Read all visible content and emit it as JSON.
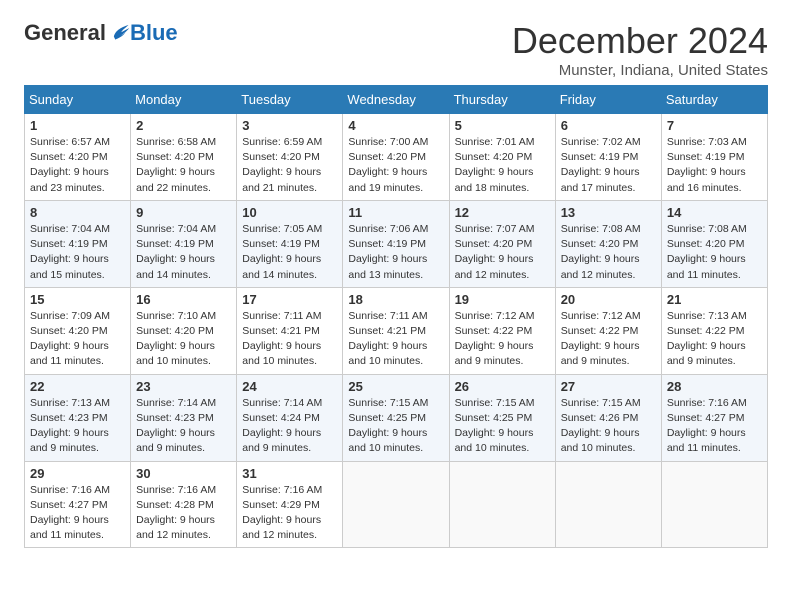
{
  "header": {
    "logo_general": "General",
    "logo_blue": "Blue",
    "title": "December 2024",
    "subtitle": "Munster, Indiana, United States"
  },
  "days_of_week": [
    "Sunday",
    "Monday",
    "Tuesday",
    "Wednesday",
    "Thursday",
    "Friday",
    "Saturday"
  ],
  "weeks": [
    [
      {
        "day": "1",
        "info": "Sunrise: 6:57 AM\nSunset: 4:20 PM\nDaylight: 9 hours\nand 23 minutes."
      },
      {
        "day": "2",
        "info": "Sunrise: 6:58 AM\nSunset: 4:20 PM\nDaylight: 9 hours\nand 22 minutes."
      },
      {
        "day": "3",
        "info": "Sunrise: 6:59 AM\nSunset: 4:20 PM\nDaylight: 9 hours\nand 21 minutes."
      },
      {
        "day": "4",
        "info": "Sunrise: 7:00 AM\nSunset: 4:20 PM\nDaylight: 9 hours\nand 19 minutes."
      },
      {
        "day": "5",
        "info": "Sunrise: 7:01 AM\nSunset: 4:20 PM\nDaylight: 9 hours\nand 18 minutes."
      },
      {
        "day": "6",
        "info": "Sunrise: 7:02 AM\nSunset: 4:19 PM\nDaylight: 9 hours\nand 17 minutes."
      },
      {
        "day": "7",
        "info": "Sunrise: 7:03 AM\nSunset: 4:19 PM\nDaylight: 9 hours\nand 16 minutes."
      }
    ],
    [
      {
        "day": "8",
        "info": "Sunrise: 7:04 AM\nSunset: 4:19 PM\nDaylight: 9 hours\nand 15 minutes."
      },
      {
        "day": "9",
        "info": "Sunrise: 7:04 AM\nSunset: 4:19 PM\nDaylight: 9 hours\nand 14 minutes."
      },
      {
        "day": "10",
        "info": "Sunrise: 7:05 AM\nSunset: 4:19 PM\nDaylight: 9 hours\nand 14 minutes."
      },
      {
        "day": "11",
        "info": "Sunrise: 7:06 AM\nSunset: 4:19 PM\nDaylight: 9 hours\nand 13 minutes."
      },
      {
        "day": "12",
        "info": "Sunrise: 7:07 AM\nSunset: 4:20 PM\nDaylight: 9 hours\nand 12 minutes."
      },
      {
        "day": "13",
        "info": "Sunrise: 7:08 AM\nSunset: 4:20 PM\nDaylight: 9 hours\nand 12 minutes."
      },
      {
        "day": "14",
        "info": "Sunrise: 7:08 AM\nSunset: 4:20 PM\nDaylight: 9 hours\nand 11 minutes."
      }
    ],
    [
      {
        "day": "15",
        "info": "Sunrise: 7:09 AM\nSunset: 4:20 PM\nDaylight: 9 hours\nand 11 minutes."
      },
      {
        "day": "16",
        "info": "Sunrise: 7:10 AM\nSunset: 4:20 PM\nDaylight: 9 hours\nand 10 minutes."
      },
      {
        "day": "17",
        "info": "Sunrise: 7:11 AM\nSunset: 4:21 PM\nDaylight: 9 hours\nand 10 minutes."
      },
      {
        "day": "18",
        "info": "Sunrise: 7:11 AM\nSunset: 4:21 PM\nDaylight: 9 hours\nand 10 minutes."
      },
      {
        "day": "19",
        "info": "Sunrise: 7:12 AM\nSunset: 4:22 PM\nDaylight: 9 hours\nand 9 minutes."
      },
      {
        "day": "20",
        "info": "Sunrise: 7:12 AM\nSunset: 4:22 PM\nDaylight: 9 hours\nand 9 minutes."
      },
      {
        "day": "21",
        "info": "Sunrise: 7:13 AM\nSunset: 4:22 PM\nDaylight: 9 hours\nand 9 minutes."
      }
    ],
    [
      {
        "day": "22",
        "info": "Sunrise: 7:13 AM\nSunset: 4:23 PM\nDaylight: 9 hours\nand 9 minutes."
      },
      {
        "day": "23",
        "info": "Sunrise: 7:14 AM\nSunset: 4:23 PM\nDaylight: 9 hours\nand 9 minutes."
      },
      {
        "day": "24",
        "info": "Sunrise: 7:14 AM\nSunset: 4:24 PM\nDaylight: 9 hours\nand 9 minutes."
      },
      {
        "day": "25",
        "info": "Sunrise: 7:15 AM\nSunset: 4:25 PM\nDaylight: 9 hours\nand 10 minutes."
      },
      {
        "day": "26",
        "info": "Sunrise: 7:15 AM\nSunset: 4:25 PM\nDaylight: 9 hours\nand 10 minutes."
      },
      {
        "day": "27",
        "info": "Sunrise: 7:15 AM\nSunset: 4:26 PM\nDaylight: 9 hours\nand 10 minutes."
      },
      {
        "day": "28",
        "info": "Sunrise: 7:16 AM\nSunset: 4:27 PM\nDaylight: 9 hours\nand 11 minutes."
      }
    ],
    [
      {
        "day": "29",
        "info": "Sunrise: 7:16 AM\nSunset: 4:27 PM\nDaylight: 9 hours\nand 11 minutes."
      },
      {
        "day": "30",
        "info": "Sunrise: 7:16 AM\nSunset: 4:28 PM\nDaylight: 9 hours\nand 12 minutes."
      },
      {
        "day": "31",
        "info": "Sunrise: 7:16 AM\nSunset: 4:29 PM\nDaylight: 9 hours\nand 12 minutes."
      },
      null,
      null,
      null,
      null
    ]
  ]
}
